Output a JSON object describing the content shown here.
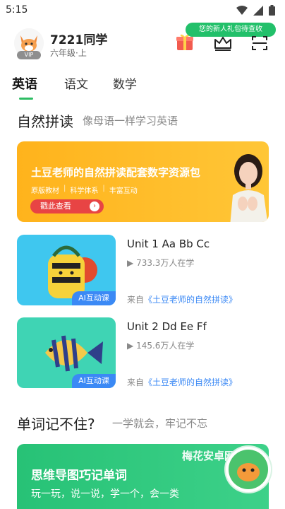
{
  "status_bar": {
    "time": "5:15"
  },
  "profile": {
    "username": "7221同学",
    "grade": "六年级·上",
    "vip_label": "VIP"
  },
  "header": {
    "gift_tooltip": "您的新人礼包待查收"
  },
  "tabs": [
    {
      "label": "英语",
      "active": true
    },
    {
      "label": "语文",
      "active": false
    },
    {
      "label": "数学",
      "active": false
    }
  ],
  "phonics": {
    "title": "自然拼读",
    "subtitle": "像母语一样学习英语",
    "banner": {
      "title": "土豆老师的自然拼读配套数字资源包",
      "tags": [
        "原版教材",
        "科学体系",
        "丰富互动"
      ],
      "button_label": "戳此查看"
    },
    "lessons": [
      {
        "title": "Unit 1 Aa Bb Cc",
        "learners": "733.3万人在学",
        "source_prefix": "来自",
        "source_name": "《土豆老师的自然拼读》",
        "tag": "AI互动课"
      },
      {
        "title": "Unit 2 Dd Ee Ff",
        "learners": "145.6万人在学",
        "source_prefix": "来自",
        "source_name": "《土豆老师的自然拼读》",
        "tag": "AI互动课"
      }
    ]
  },
  "vocab": {
    "title": "单词记不住?",
    "subtitle": "一学就会，牢记不忘",
    "banner": {
      "title": "思维导图巧记单词",
      "subtitle": "玩一玩，说一说，学一个，会一类"
    }
  },
  "watermark": "梅花安卓网",
  "colors": {
    "accent_green": "#2dbd63",
    "banner_orange": "#ffb31c",
    "link_blue": "#3b89f5",
    "button_red": "#e84444"
  }
}
